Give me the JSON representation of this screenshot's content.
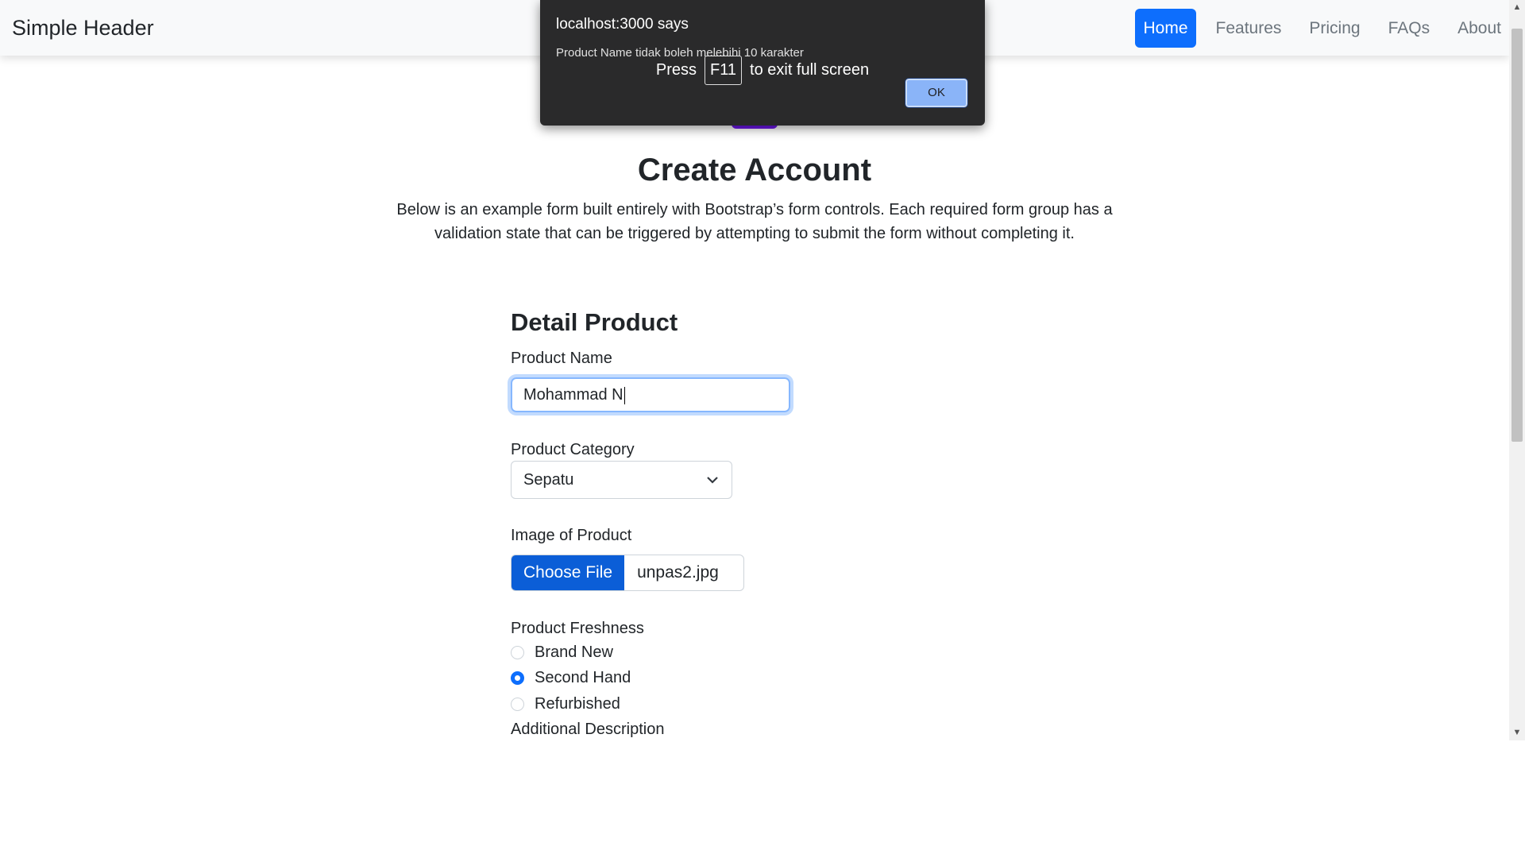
{
  "navbar": {
    "brand": "Simple Header",
    "links": [
      {
        "label": "Home",
        "active": true
      },
      {
        "label": "Features",
        "active": false
      },
      {
        "label": "Pricing",
        "active": false
      },
      {
        "label": "FAQs",
        "active": false
      },
      {
        "label": "About",
        "active": false
      }
    ]
  },
  "hero": {
    "title": "Create Account",
    "lead": "Below is an example form built entirely with Bootstrap’s form controls. Each required form group has a validation state that can be triggered by attempting to submit the form without completing it."
  },
  "form": {
    "section_title": "Detail Product",
    "product_name_label": "Product Name",
    "product_name_value": "Mohammad N",
    "category_label": "Product Category",
    "category_value": "Sepatu",
    "image_label": "Image of Product",
    "choose_file_label": "Choose File",
    "file_name": "unpas2.jpg",
    "freshness_label": "Product Freshness",
    "freshness_options": [
      {
        "label": "Brand New",
        "checked": false
      },
      {
        "label": "Second Hand",
        "checked": true
      },
      {
        "label": "Refurbished",
        "checked": false
      }
    ],
    "additional_label": "Additional Description"
  },
  "alert": {
    "title": "localhost:3000 says",
    "message": "Product Name tidak boleh melebihi 10 karakter",
    "ok_label": "OK"
  },
  "fullscreen_toast": {
    "press": "Press",
    "key": "F11",
    "suffix": "to exit full screen"
  },
  "colors": {
    "primary": "#0d6efd",
    "dialog_bg": "#2a2a2b",
    "ok_button": "#8ab4f8"
  }
}
